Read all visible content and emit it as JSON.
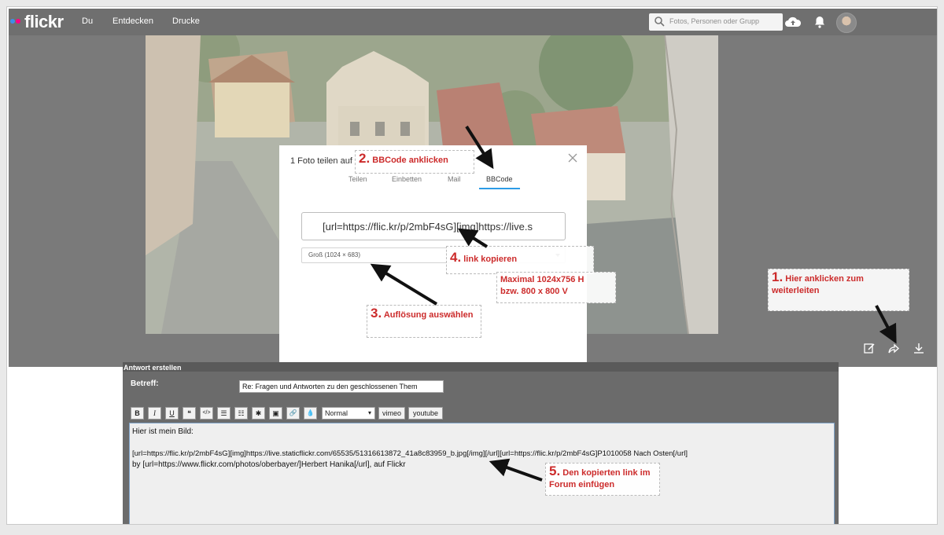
{
  "flickr": {
    "logo": "flickr",
    "nav": [
      "Du",
      "Entdecken",
      "Drucke"
    ],
    "search_placeholder": "Fotos, Personen oder Grupp",
    "colors": {
      "dot_blue": "#3d8ee8",
      "dot_pink": "#ff0084",
      "accent": "#2c9be6"
    }
  },
  "dialog": {
    "title": "1 Foto teilen auf",
    "tabs": [
      "Teilen",
      "Einbetten",
      "Mail",
      "BBCode"
    ],
    "active_tab": "BBCode",
    "link_value": "[url=https://flic.kr/p/2mbF4sG][img]https://live.s",
    "size_value": "Groß (1024 × 683)"
  },
  "annotations": {
    "a1_num": "1.",
    "a1_text": "Hier anklicken zum weiterleiten",
    "a2_num": "2.",
    "a2_text": "BBCode anklicken",
    "a3_num": "3.",
    "a3_text": "Auflösung auswählen",
    "a4_num": "4.",
    "a4_text": "link kopieren",
    "a5_num": "5.",
    "a5_text": "Den kopierten link im Forum einfügen",
    "max_line1": "Maximal  1024x756 H",
    "max_line2": "bzw. 800 x 800 V"
  },
  "forum": {
    "title": "Antwort erstellen",
    "subject_label": "Betreff:",
    "subject_value": "Re: Fragen und Antworten zu den geschlossenen Them",
    "toolbar": {
      "bold": "B",
      "italic": "I",
      "underline": "U",
      "quote": "❝",
      "code": "</>",
      "list": "☰",
      "olist": "☷",
      "star": "✱",
      "image": "▣",
      "link": "🔗",
      "color": "💧",
      "font_size": "Normal",
      "vimeo": "vimeo",
      "youtube": "youtube"
    },
    "editor_lines": [
      "Hier ist mein Bild:",
      "",
      "[url=https://flic.kr/p/2mbF4sG][img]https://live.staticflickr.com/65535/51316613872_41a8c83959_b.jpg[/img][/url][url=https://flic.kr/p/2mbF4sG]P1010058 Nach Osten[/url]",
      "by [url=https://www.flickr.com/photos/oberbayer/]Herbert Hanika[/url], auf Flickr"
    ]
  }
}
